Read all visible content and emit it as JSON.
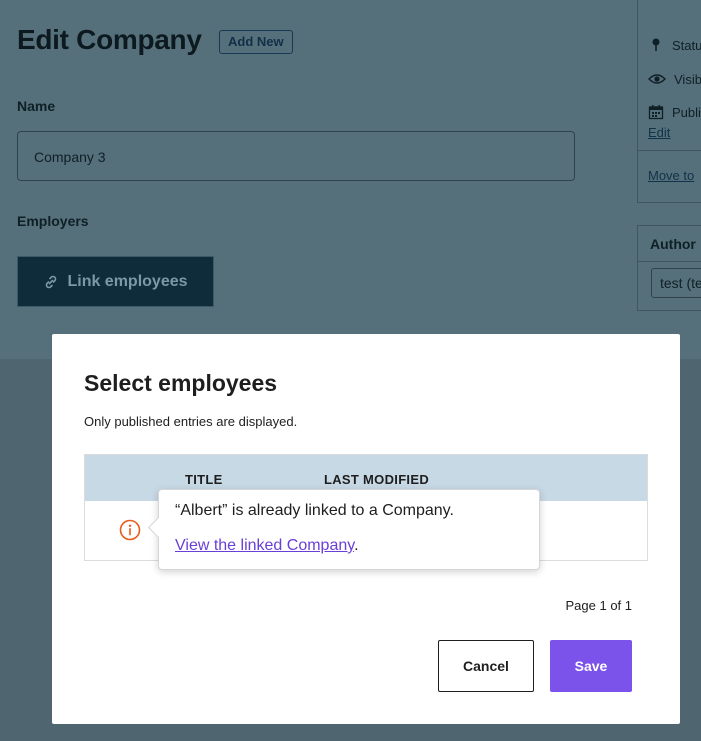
{
  "page": {
    "title": "Edit Company",
    "add_new_label": "Add New",
    "name_label": "Name",
    "name_value": "Company 3",
    "employers_label": "Employers",
    "link_employees_label": "Link employees"
  },
  "sidebar": {
    "publish_rows": [
      {
        "icon": "pin-icon",
        "label": "Statu"
      },
      {
        "icon": "eye-icon",
        "label": "Visib"
      },
      {
        "icon": "calendar-icon",
        "label": "Publi"
      }
    ],
    "edit_link": "Edit",
    "move_to_trash": "Move to",
    "author_title": "Author",
    "author_value": "test (te"
  },
  "modal": {
    "title": "Select employees",
    "subtitle": "Only published entries are displayed.",
    "columns": [
      "TITLE",
      "LAST MODIFIED"
    ],
    "pagination": "Page 1 of 1",
    "cancel_label": "Cancel",
    "save_label": "Save"
  },
  "popover": {
    "message": "“Albert” is already linked to a Company.",
    "link_text": "View the linked Company",
    "link_suffix": "."
  },
  "colors": {
    "save_button": "#7b52ea",
    "info_icon": "#e65c1a",
    "link": "#6a3fd6"
  }
}
